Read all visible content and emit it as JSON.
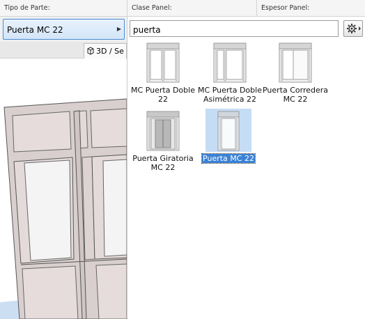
{
  "headers": {
    "tipo": "Tipo de Parte:",
    "clase": "Clase Panel:",
    "espesor": "Espesor Panel:"
  },
  "part_type": {
    "value": "Puerta MC 22"
  },
  "view_tab": {
    "label": "3D / Se"
  },
  "search": {
    "value": "puerta"
  },
  "tiles": [
    {
      "line1": "MC Puerta Doble",
      "line2": "22"
    },
    {
      "line1": "MC Puerta Doble",
      "line2": "Asimétrica 22"
    },
    {
      "line1": "Puerta Corredera",
      "line2": "MC 22"
    },
    {
      "line1": "Puerta Giratoria",
      "line2": "MC 22"
    },
    {
      "line1": "Puerta MC 22",
      "selected": true
    }
  ],
  "icons": {
    "options": "gear-icon",
    "view": "cube-icon",
    "dropdown": "triangle-right-icon"
  },
  "colors": {
    "accent": "#3a82d6",
    "selection_bg": "#c5dcf5",
    "field_border": "#4a8ad0"
  }
}
